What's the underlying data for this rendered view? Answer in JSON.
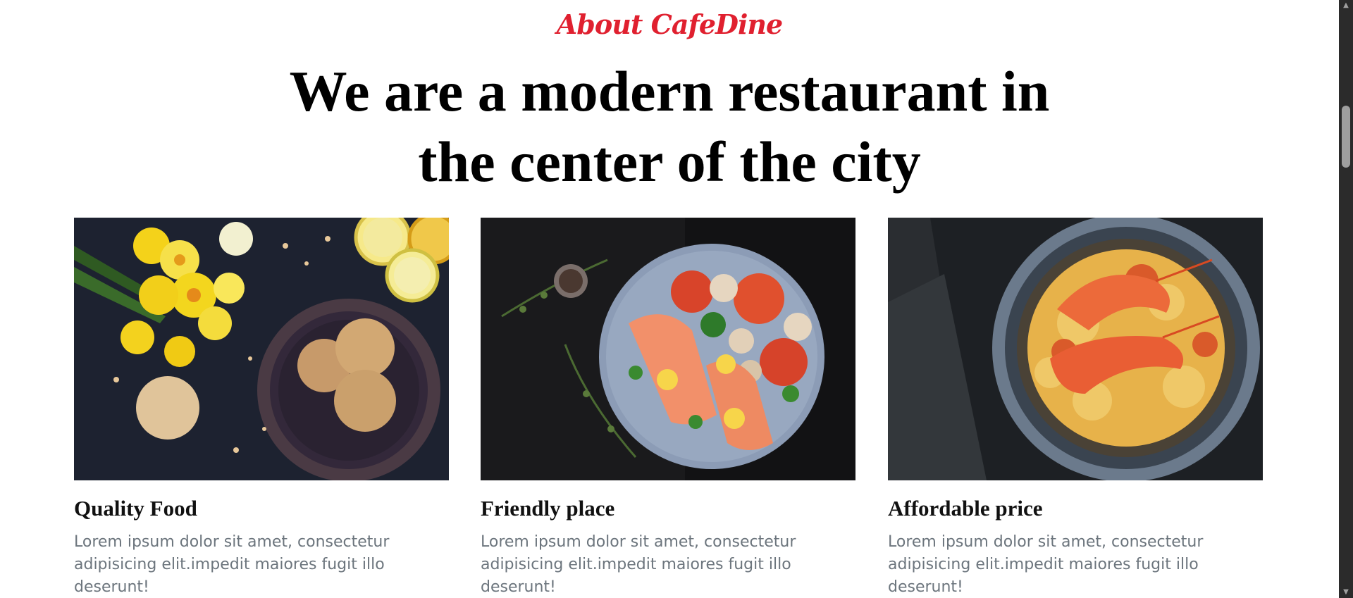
{
  "about": {
    "eyebrow": "About CafeDine",
    "headline": "We are a modern restaurant in the center of the city"
  },
  "features": [
    {
      "image": "cookies-and-daffodils-photo",
      "title": "Quality Food",
      "text": "Lorem ipsum dolor sit amet, consectetur adipisicing elit.impedit maiores fugit illo deserunt!"
    },
    {
      "image": "salmon-plate-photo",
      "title": "Friendly place",
      "text": "Lorem ipsum dolor sit amet, consectetur adipisicing elit.impedit maiores fugit illo deserunt!"
    },
    {
      "image": "shrimp-pasta-photo",
      "title": "Affordable price",
      "text": "Lorem ipsum dolor sit amet, consectetur adipisicing elit.impedit maiores fugit illo deserunt!"
    }
  ],
  "colors": {
    "accent": "#e0202f",
    "heading": "#000000",
    "body_text": "#6c757d",
    "scrollbar": "#2b2b2b"
  },
  "scrollbar": {
    "up_icon": "scroll-up-arrow-icon",
    "down_icon": "scroll-down-arrow-icon"
  }
}
